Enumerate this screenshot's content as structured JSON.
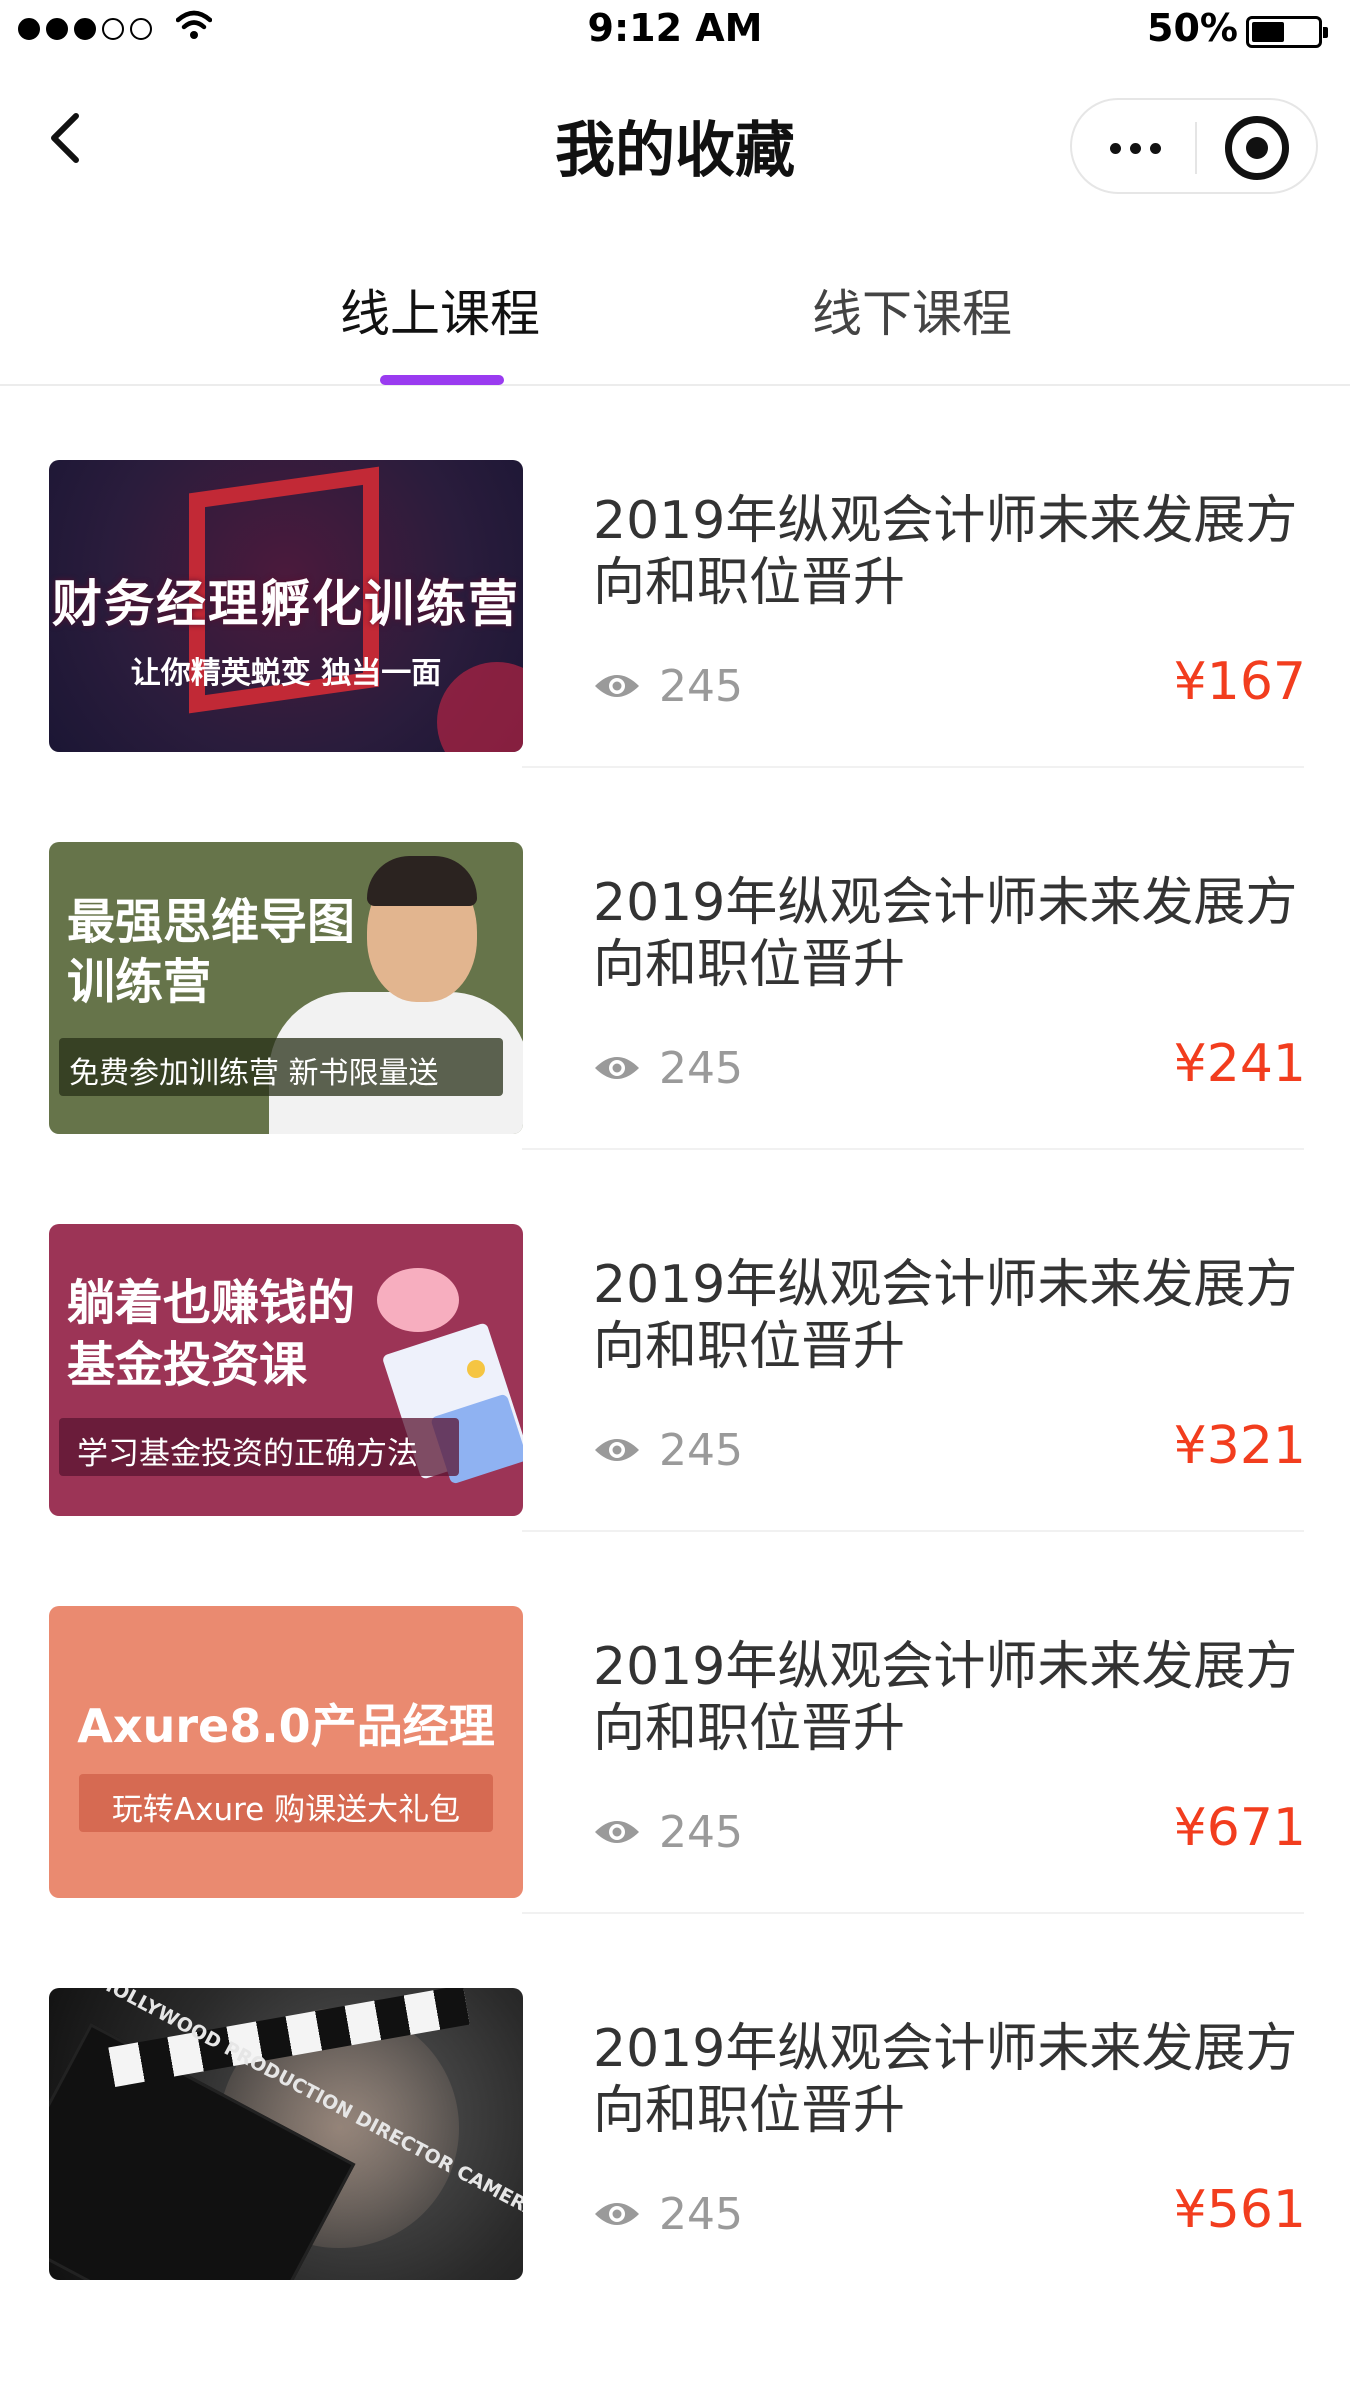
{
  "status_bar": {
    "time": "9:12 AM",
    "battery_percent_text": "50%",
    "battery_level": 0.5
  },
  "nav": {
    "title": "我的收藏",
    "back_icon": "chevron-left-icon",
    "more_icon": "more-dots-icon",
    "close_icon": "target-close-icon"
  },
  "tabs": [
    {
      "label": "线上课程",
      "active": true
    },
    {
      "label": "线下课程",
      "active": false
    }
  ],
  "colors": {
    "accent": "#9a3bf0",
    "price": "#f23d1e"
  },
  "courses": [
    {
      "title": "2019年纵观会计师未来发展方向和职位晋升",
      "views": "245",
      "price": "¥167",
      "thumb": {
        "headline": "财务经理孵化训练营",
        "sub": "让你精英蜕变 独当一面"
      }
    },
    {
      "title": "2019年纵观会计师未来发展方向和职位晋升",
      "views": "245",
      "price": "¥241",
      "thumb": {
        "headline": "最强思维导图训练营",
        "sub": "免费参加训练营 新书限量送"
      }
    },
    {
      "title": "2019年纵观会计师未来发展方向和职位晋升",
      "views": "245",
      "price": "¥321",
      "thumb": {
        "headline": "躺着也赚钱的基金投资课",
        "sub": "学习基金投资的正确方法"
      }
    },
    {
      "title": "2019年纵观会计师未来发展方向和职位晋升",
      "views": "245",
      "price": "¥671",
      "thumb": {
        "headline": "Axure8.0产品经理",
        "sub": "玩转Axure 购课送大礼包"
      }
    },
    {
      "title": "2019年纵观会计师未来发展方向和职位晋升",
      "views": "245",
      "price": "¥561",
      "thumb": {
        "headline": "HOLLYWOOD PRODUCTION DIRECTOR CAMERA DATE SCENE TAKE",
        "sub": ""
      }
    }
  ]
}
